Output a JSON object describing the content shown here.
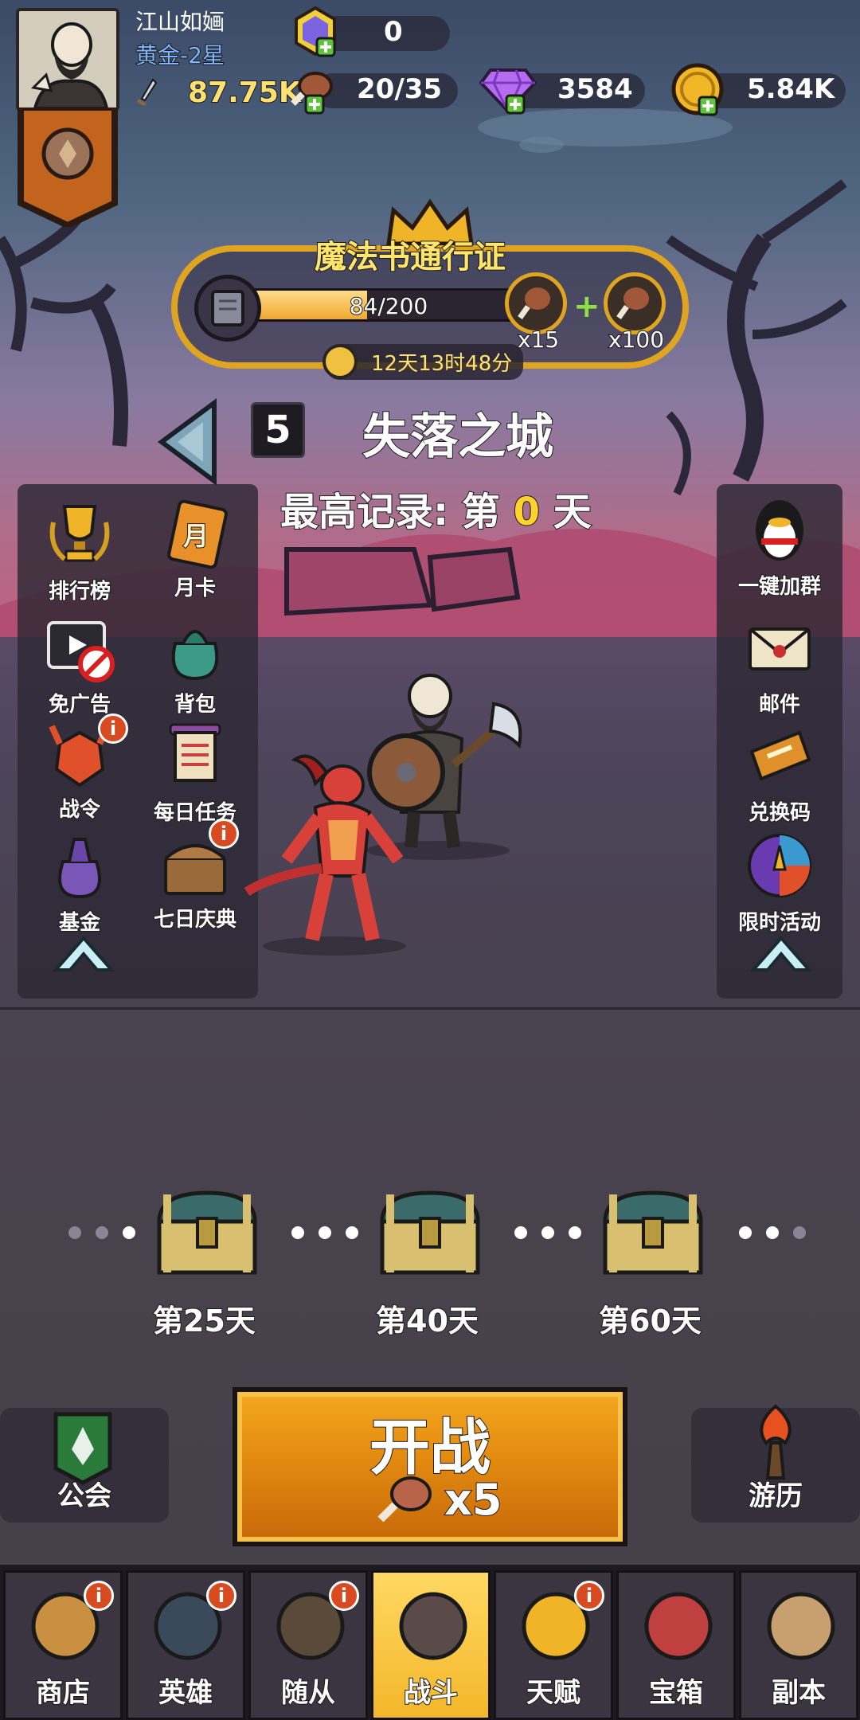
{
  "player": {
    "name": "江山如婳",
    "rank": "黄金-2星",
    "power": "87.75K"
  },
  "resources": {
    "energy_gem": "0",
    "meat": "20/35",
    "diamond": "3584",
    "gold": "5.84K"
  },
  "battle_pass": {
    "title": "魔法书通行证",
    "progress_text": "84/200",
    "progress_fraction": 0.42,
    "reward_1_count": "x15",
    "reward_2_count": "x100",
    "timer": "12天13时48分"
  },
  "stage": {
    "number": "5",
    "name": "失落之城",
    "best_record_prefix": "最高记录: 第",
    "best_record_value": "0",
    "best_record_suffix": "天"
  },
  "left_menu": [
    {
      "label": "排行榜",
      "icon": "trophy-icon"
    },
    {
      "label": "月卡",
      "icon": "month-card-icon",
      "icon_text": "月"
    },
    {
      "label": "免广告",
      "icon": "no-ads-icon"
    },
    {
      "label": "背包",
      "icon": "bag-icon"
    },
    {
      "label": "战令",
      "icon": "battle-order-icon",
      "badge": "i"
    },
    {
      "label": "每日任务",
      "icon": "daily-task-icon"
    },
    {
      "label": "基金",
      "icon": "fund-icon"
    },
    {
      "label": "七日庆典",
      "icon": "seven-day-icon",
      "badge": "i"
    }
  ],
  "right_menu": [
    {
      "label": "一键加群",
      "icon": "qq-penguin-icon"
    },
    {
      "label": "邮件",
      "icon": "mail-icon"
    },
    {
      "label": "兑换码",
      "icon": "redeem-code-icon"
    },
    {
      "label": "限时活动",
      "icon": "limited-event-icon"
    }
  ],
  "milestones": [
    {
      "label": "第25天"
    },
    {
      "label": "第40天"
    },
    {
      "label": "第60天"
    }
  ],
  "fight": {
    "label": "开战",
    "cost": "x5"
  },
  "guild_button": "公会",
  "travel_button": "游历",
  "nav": [
    {
      "label": "商店",
      "badge": "i",
      "active": false
    },
    {
      "label": "英雄",
      "badge": "i",
      "active": false
    },
    {
      "label": "随从",
      "badge": "i",
      "active": false
    },
    {
      "label": "战斗",
      "badge": "",
      "active": true
    },
    {
      "label": "天赋",
      "badge": "i",
      "active": false
    },
    {
      "label": "宝箱",
      "badge": "",
      "active": false
    },
    {
      "label": "副本",
      "badge": "",
      "active": false
    }
  ],
  "colors": {
    "gold_accent": "#e0a520",
    "rank_blue": "#7db6ff",
    "badge_red": "#d84a20",
    "fight_orange": "#e28a10"
  }
}
